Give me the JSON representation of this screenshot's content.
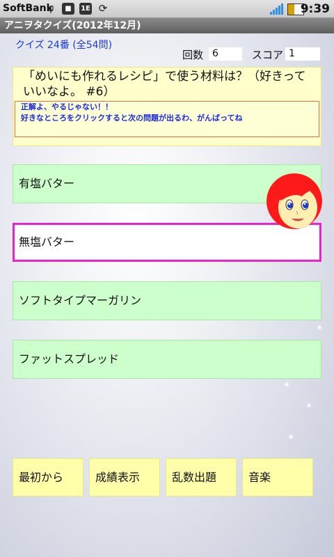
{
  "status_bar": {
    "carrier": "SoftBank",
    "time": "9:39",
    "icons": [
      "usb-icon",
      "android-icon",
      "app-badge-icon",
      "sync-icon",
      "signal-icon",
      "battery-icon"
    ],
    "app_badge_text": "1E"
  },
  "app": {
    "title": "アニヲタクイズ(2012年12月)"
  },
  "quiz": {
    "number_text": "クイズ 24番 (全54問)",
    "count_label": "回数",
    "count_value": "6",
    "score_label": "スコア",
    "score_value": "1",
    "question": "「めいにも作れるレシピ」で使う材料は？（好きっていいなよ。 #6）",
    "feedback": [
      "正解よ、やるじゃない！！",
      "好きなところをクリックすると次の問題が出るわ、がんばってね"
    ],
    "answers": [
      {
        "label": "有塩バター",
        "selected": false
      },
      {
        "label": "無塩バター",
        "selected": true
      },
      {
        "label": "ソフトタイプマーガリン",
        "selected": false
      },
      {
        "label": "ファットスプレッド",
        "selected": false
      }
    ]
  },
  "bottom_buttons": [
    {
      "label": "最初から"
    },
    {
      "label": "成績表示"
    },
    {
      "label": "乱数出題"
    },
    {
      "label": "音楽"
    }
  ],
  "colors": {
    "accent_blue": "#1a3ad8",
    "answer_green": "#ccffcc",
    "selected_border": "#ee22cc",
    "question_bg": "#ffffcc",
    "button_yellow": "#ffffaa",
    "feedback_border": "#e86a50"
  }
}
